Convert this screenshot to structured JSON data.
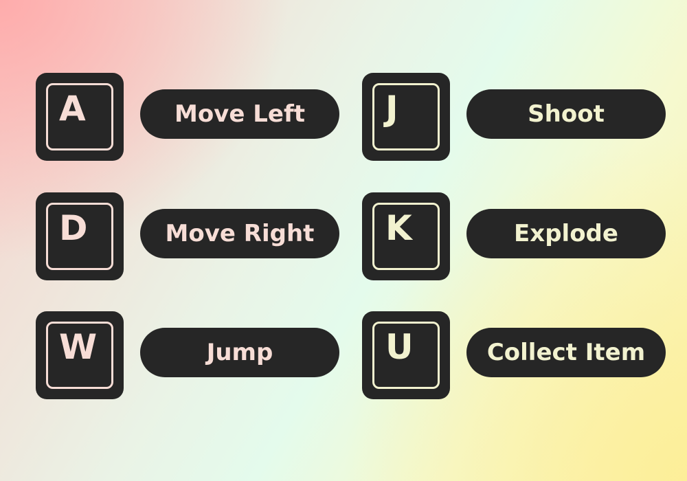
{
  "controls": [
    {
      "key": "A",
      "action": "Move Left"
    },
    {
      "key": "D",
      "action": "Move Right"
    },
    {
      "key": "W",
      "action": "Jump"
    },
    {
      "key": "J",
      "action": "Shoot"
    },
    {
      "key": "K",
      "action": "Explode"
    },
    {
      "key": "U",
      "action": "Collect Item"
    }
  ],
  "colors": {
    "key_bg": "#262626",
    "left_text": "#f7ddd6",
    "right_text": "#f2f2cf"
  }
}
